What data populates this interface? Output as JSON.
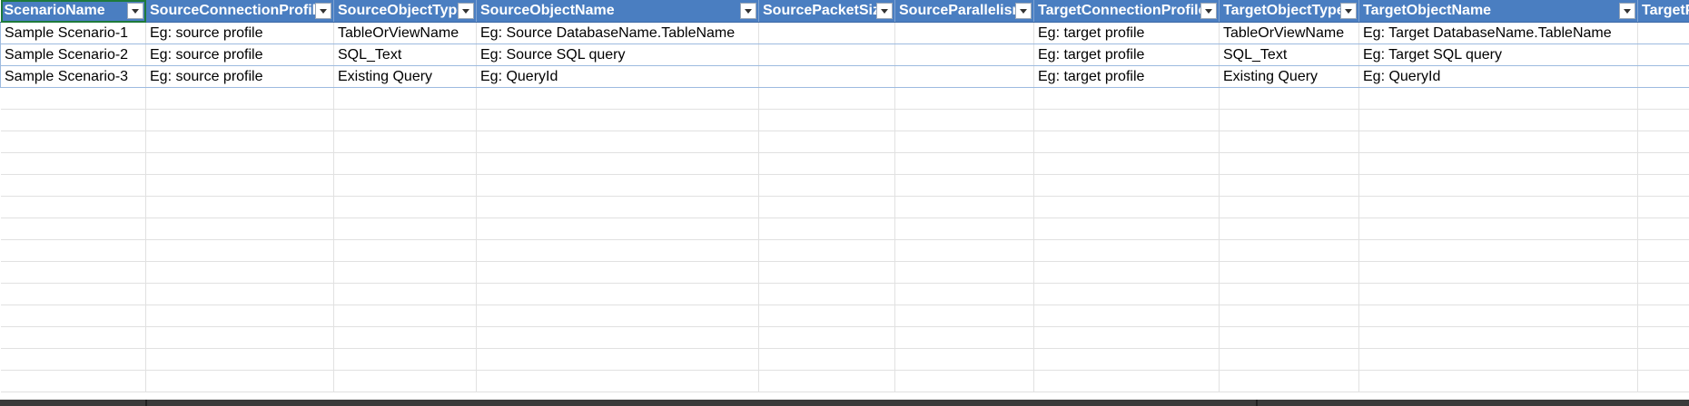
{
  "sheet": {
    "columns": [
      "ScenarioName",
      "SourceConnectionProfile",
      "SourceObjectType",
      "SourceObjectName",
      "SourcePacketSize",
      "SourceParallelism",
      "TargetConnectionProfile",
      "TargetObjectType",
      "TargetObjectName",
      "TargetP"
    ],
    "rows": [
      [
        "Sample Scenario-1",
        "Eg: source profile",
        "TableOrViewName",
        "Eg: Source DatabaseName.TableName",
        "",
        "",
        "Eg: target profile",
        "TableOrViewName",
        "Eg: Target DatabaseName.TableName",
        ""
      ],
      [
        "Sample Scenario-2",
        "Eg: source profile",
        "SQL_Text",
        "Eg: Source SQL query",
        "",
        "",
        "Eg: target profile",
        "SQL_Text",
        "Eg: Target SQL query",
        ""
      ],
      [
        "Sample Scenario-3",
        "Eg: source profile",
        "Existing Query",
        "Eg: QueryId",
        "",
        "",
        "Eg: target profile",
        "Existing Query",
        "Eg: QueryId",
        ""
      ]
    ],
    "empty_row_count": 14,
    "header_color": "#4a7ec1",
    "active_cell_color": "#1e7a3a"
  },
  "icons": {
    "filter": "dropdown-filter-icon"
  }
}
